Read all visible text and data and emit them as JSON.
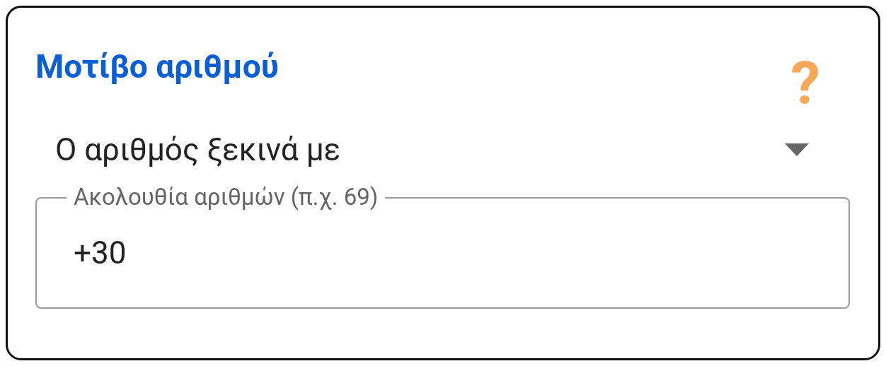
{
  "card": {
    "title": "Μοτίβο αριθμού",
    "help_icon": "?"
  },
  "dropdown": {
    "value": "Ο αριθμός ξεκινά με"
  },
  "field": {
    "label": "Ακολουθία αριθμών (π.χ. 69)",
    "value": "+30"
  }
}
